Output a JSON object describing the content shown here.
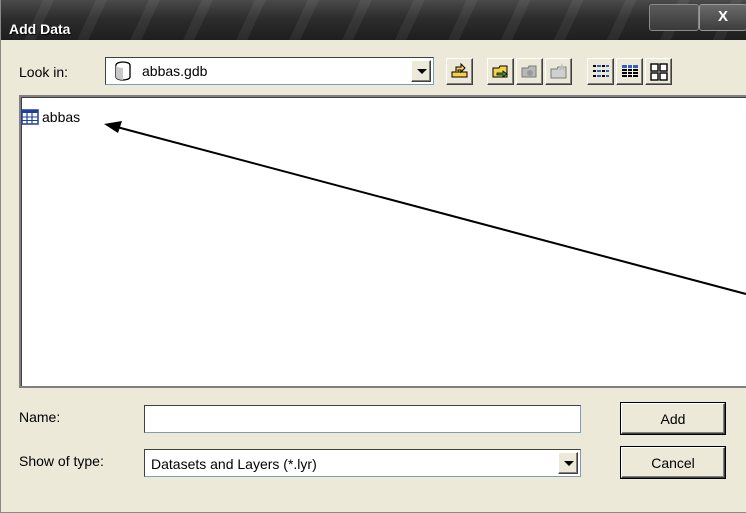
{
  "window": {
    "title": "Add Data",
    "close_label": "X"
  },
  "lookin": {
    "label": "Look in:",
    "value": "abbas.gdb"
  },
  "toolbar": {
    "icons": [
      "up-one-level-icon",
      "connect-to-folder-icon",
      "disconnect-folder-icon",
      "new-folder-icon",
      "list-view-icon",
      "details-view-icon",
      "thumbnails-view-icon"
    ]
  },
  "files": {
    "items": [
      {
        "name": "abbas",
        "icon": "table-icon"
      }
    ]
  },
  "name_field": {
    "label": "Name:",
    "value": ""
  },
  "type_field": {
    "label": "Show of type:",
    "value": "Datasets and Layers (*.lyr)"
  },
  "buttons": {
    "add": "Add",
    "cancel": "Cancel"
  },
  "colors": {
    "titlebar": "#2d2d2d",
    "dialog_bg": "#ece9d8",
    "list_bg": "#ffffff"
  }
}
